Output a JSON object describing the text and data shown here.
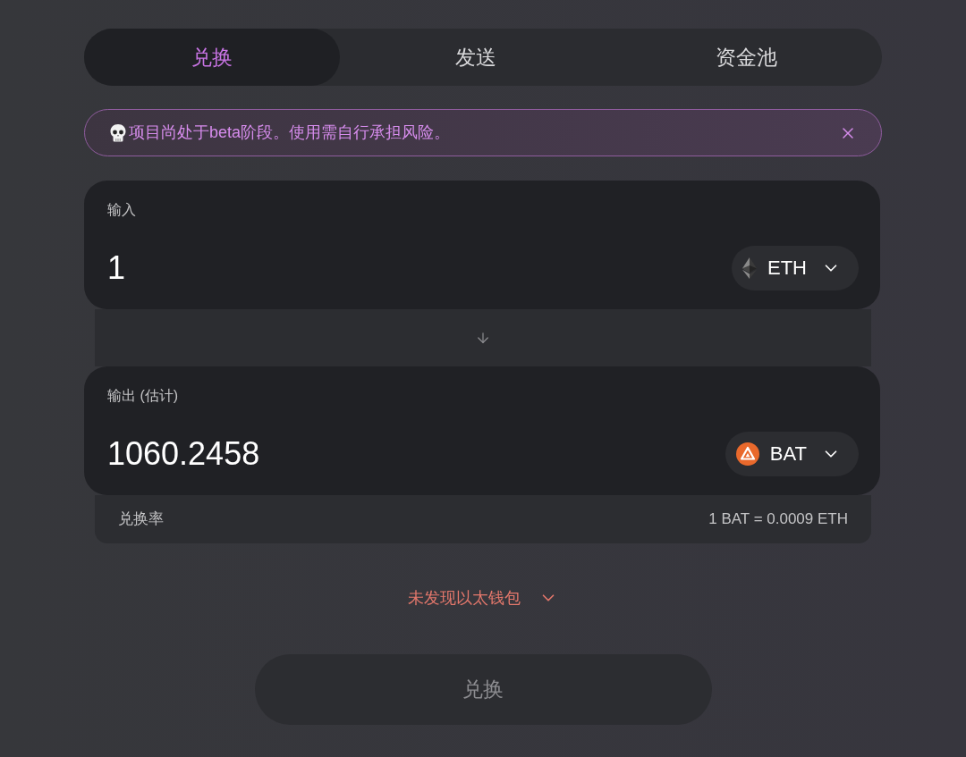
{
  "tabs": [
    {
      "label": "兑换",
      "selected": true
    },
    {
      "label": "发送",
      "selected": false
    },
    {
      "label": "资金池",
      "selected": false
    }
  ],
  "banner": {
    "text": "项目尚处于beta阶段。使用需自行承担风险。"
  },
  "input": {
    "label": "输入",
    "value": "1",
    "token": "ETH"
  },
  "output": {
    "label": "输出 (估计)",
    "value": "1060.2458",
    "token": "BAT"
  },
  "rate": {
    "label": "兑换率",
    "value": "1 BAT = 0.0009 ETH"
  },
  "wallet_warning": {
    "text": "未发现以太钱包"
  },
  "swap_button": {
    "label": "兑换",
    "disabled": true
  }
}
